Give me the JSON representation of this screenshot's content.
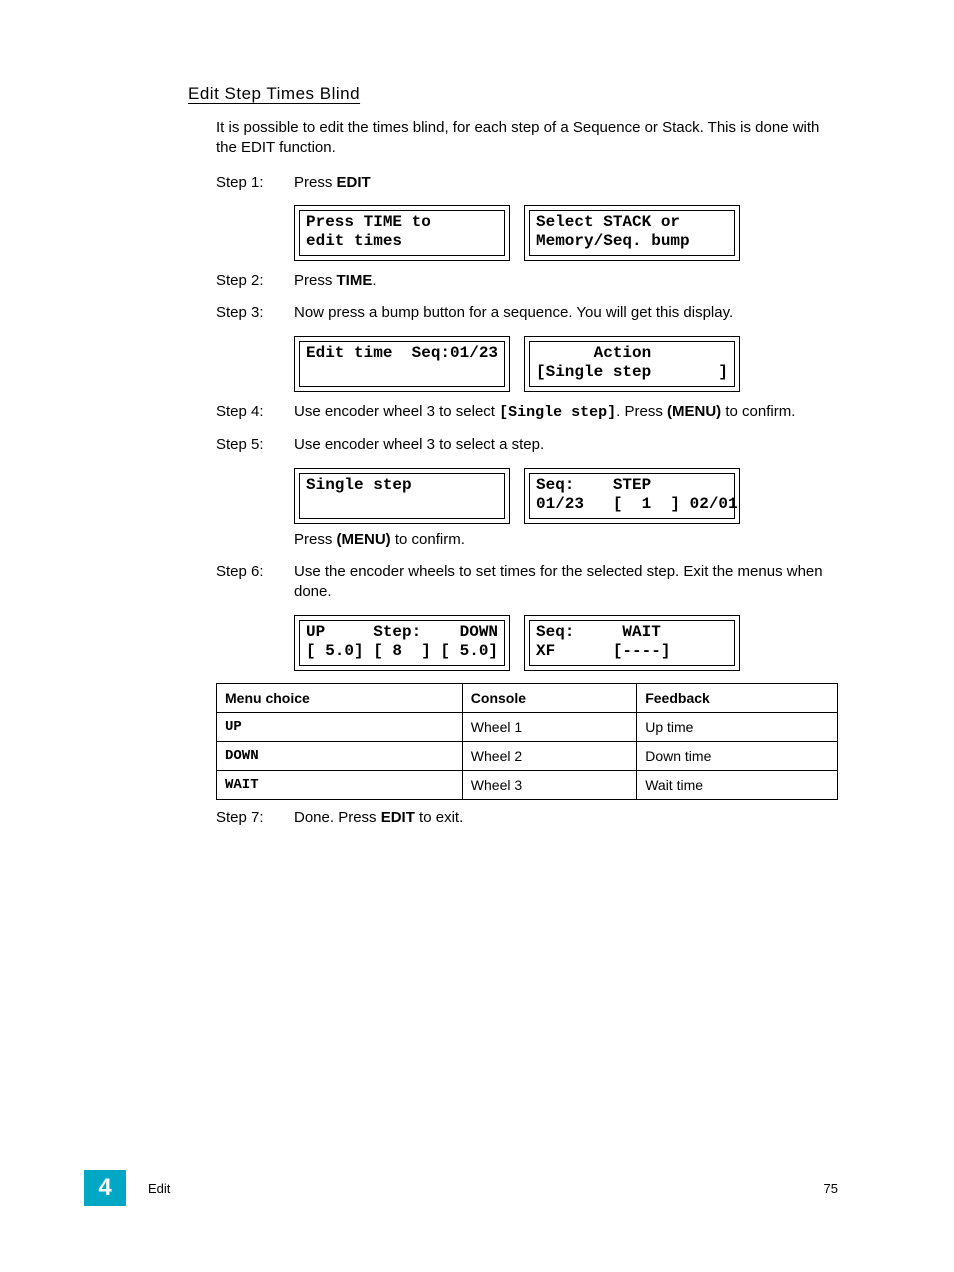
{
  "section_title": "Edit Step Times Blind",
  "intro": "It is possible to edit the times blind, for each step of a Sequence or Stack. This is done with the EDIT function.",
  "steps": {
    "s1": {
      "label": "Step 1:",
      "text_prefix": "Press ",
      "key": "EDIT"
    },
    "s2": {
      "label": "Step 2:",
      "text_prefix": "Press ",
      "key": "TIME",
      "suffix": "."
    },
    "s3": {
      "label": "Step 3:",
      "text": "Now press a bump button for a sequence. You will get this display."
    },
    "s4": {
      "label": "Step 4:",
      "pre": "Use encoder wheel 3 to select ",
      "code": "[Single step]",
      "mid": ". Press ",
      "menu": "(MENU)",
      "post": " to confirm."
    },
    "s5": {
      "label": "Step 5:",
      "text": "Use encoder wheel 3 to select a step.",
      "confirm_pre": "Press ",
      "confirm_menu": "(MENU)",
      "confirm_post": " to confirm."
    },
    "s6": {
      "label": "Step 6:",
      "text": "Use the encoder wheels to set times for the selected step. Exit the menus when done."
    },
    "s7": {
      "label": "Step 7:",
      "pre": "Done. Press ",
      "key": "EDIT",
      "post": " to exit."
    }
  },
  "lcd": {
    "pair1_left": "Press TIME to\nedit times",
    "pair1_right": "Select STACK or\nMemory/Seq. bump",
    "pair2_left": "Edit time  Seq:01/23",
    "pair2_right": "      Action\n[Single step       ]",
    "pair3_left": "Single step",
    "pair3_right": "Seq:    STEP\n01/23   [  1  ] 02/01",
    "pair4_left": "UP     Step:    DOWN\n[ 5.0] [ 8  ] [ 5.0]",
    "pair4_right": "Seq:     WAIT\nXF      [----]"
  },
  "table": {
    "headers": {
      "c1": "Menu choice",
      "c2": "Console",
      "c3": "Feedback"
    },
    "rows": [
      {
        "c1": "UP",
        "c2": "Wheel 1",
        "c3": "Up time"
      },
      {
        "c1": "DOWN",
        "c2": "Wheel 2",
        "c3": "Down time"
      },
      {
        "c1": "WAIT",
        "c2": "Wheel 3",
        "c3": "Wait time"
      }
    ]
  },
  "footer": {
    "chapter_num": "4",
    "chapter_name": "Edit",
    "page_num": "75"
  }
}
